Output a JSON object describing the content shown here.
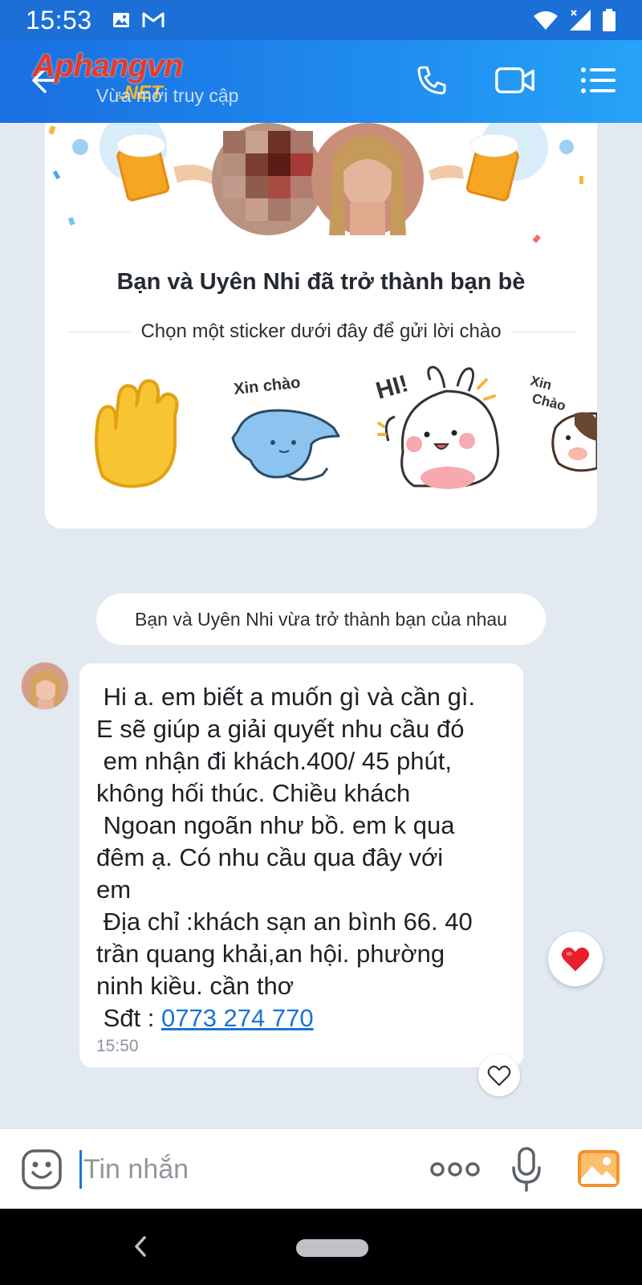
{
  "status_bar": {
    "time": "15:53",
    "left_icons": [
      "image-icon",
      "gmail-icon"
    ],
    "right_icons": [
      "wifi-icon",
      "signal-icon",
      "battery-icon"
    ]
  },
  "header": {
    "logo_text": "Aphangvn",
    "logo_sub": ".NET",
    "subtitle": "Vừa mới truy cập",
    "actions": [
      "phone-icon",
      "video-call-icon",
      "menu-icon"
    ]
  },
  "friend_card": {
    "title": "Bạn và Uyên Nhi đã trở thành bạn bè",
    "subtitle": "Chọn một sticker dưới đây để gửi lời chào",
    "stickers": [
      {
        "name": "wave-hand",
        "label": ""
      },
      {
        "name": "blue-cat",
        "label": "Xin chào"
      },
      {
        "name": "bunny-hi",
        "label": "HI!"
      },
      {
        "name": "cow-xin-chao",
        "label": "Xin Chào"
      }
    ]
  },
  "system_message": "Bạn và Uyên Nhi vừa trở thành bạn của nhau",
  "message": {
    "lines": [
      " Hi a. em biết a muốn gì và cần gì.",
      "E sẽ giúp a giải quyết nhu cầu đó",
      " em nhận đi khách.400/ 45 phút,",
      "không hối thúc. Chiều khách",
      " Ngoan ngoãn như bồ. em k qua",
      "đêm ạ. Có nhu cầu qua đây với",
      "em",
      " Địa chỉ :khách sạn an bình 66. 40",
      "trần quang khải,an hội. phường",
      "ninh kiều. cần thơ"
    ],
    "phone_prefix": " Sđt : ",
    "phone": "0773 274 770",
    "time": "15:50"
  },
  "input": {
    "placeholder": "Tin nhắn",
    "value": ""
  },
  "colors": {
    "header_start": "#1a6fe0",
    "header_end": "#26a3f6",
    "background": "#e2e9f1",
    "link": "#1a73d9",
    "heart": "#e8202e"
  }
}
